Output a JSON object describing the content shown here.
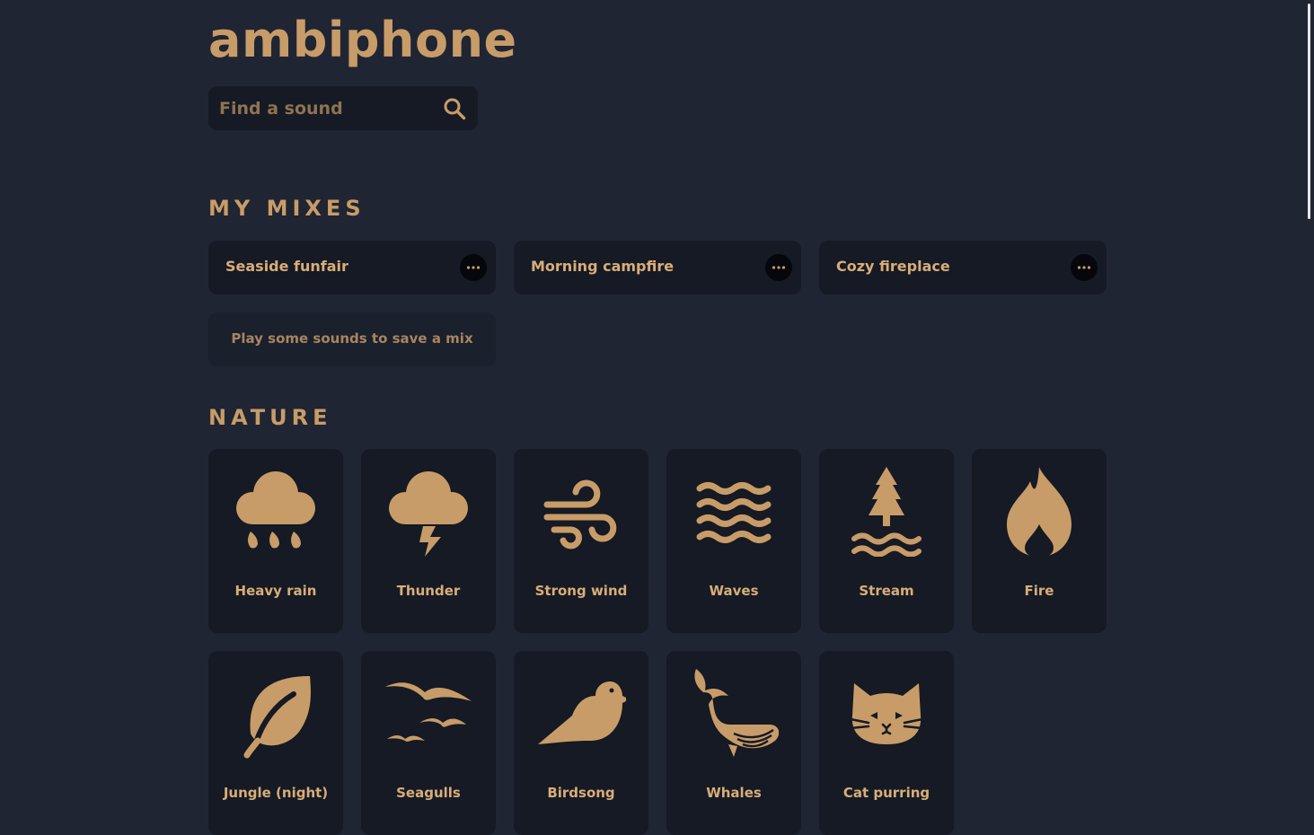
{
  "app": {
    "logo": "ambiphone"
  },
  "search": {
    "placeholder": "Find a sound"
  },
  "sections": {
    "mixes_title": "MY MIXES",
    "nature_title": "NATURE"
  },
  "mixes": [
    {
      "name": "Seaside funfair"
    },
    {
      "name": "Morning campfire"
    },
    {
      "name": "Cozy fireplace"
    }
  ],
  "empty_mix_hint": "Play some sounds to save a mix",
  "sounds": [
    {
      "label": "Heavy rain",
      "icon": "rain-cloud-icon"
    },
    {
      "label": "Thunder",
      "icon": "thunder-cloud-icon"
    },
    {
      "label": "Strong wind",
      "icon": "wind-icon"
    },
    {
      "label": "Waves",
      "icon": "waves-icon"
    },
    {
      "label": "Stream",
      "icon": "tree-stream-icon"
    },
    {
      "label": "Fire",
      "icon": "flame-icon"
    },
    {
      "label": "Jungle (night)",
      "icon": "leaf-icon"
    },
    {
      "label": "Seagulls",
      "icon": "seagulls-icon"
    },
    {
      "label": "Birdsong",
      "icon": "bird-icon"
    },
    {
      "label": "Whales",
      "icon": "whale-icon"
    },
    {
      "label": "Cat purring",
      "icon": "cat-icon"
    }
  ],
  "colors": {
    "background": "#1f2533",
    "card": "#151a24",
    "accent": "#c89c68"
  }
}
